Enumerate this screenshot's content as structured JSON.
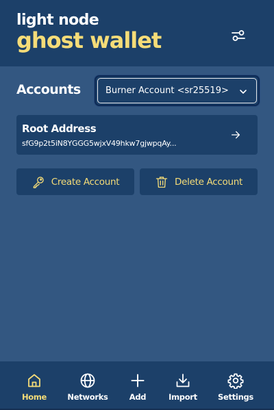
{
  "brand": {
    "top_text": "light node",
    "main_text": "ghost wallet"
  },
  "accounts": {
    "label": "Accounts",
    "selected": "Burner Account <sr25519>"
  },
  "root_address": {
    "title": "Root Address",
    "address": "sfG9p2t5iN8YGGG5wjxV49hkw7gjwpqAy..."
  },
  "actions": {
    "create_label": "Create Account",
    "delete_label": "Delete Account"
  },
  "nav": {
    "home": "Home",
    "networks": "Networks",
    "add": "Add",
    "import": "Import",
    "settings": "Settings",
    "active": "home"
  },
  "colors": {
    "accent": "#f5dc78",
    "background": "#335781",
    "panel": "#1c4069"
  },
  "icons": {
    "header": "sliders-icon",
    "select": "chevron-down-icon",
    "root": "arrow-right-icon",
    "create": "key-icon",
    "delete": "trash-icon",
    "home": "home-icon",
    "networks": "globe-icon",
    "add": "plus-icon",
    "import": "download-icon",
    "settings": "gear-icon"
  }
}
